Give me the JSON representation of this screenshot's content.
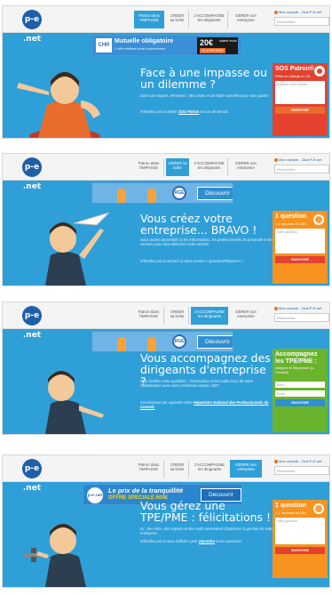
{
  "nav": {
    "items": [
      "Patron dans l'IMPASSE",
      "CRÉER sa boîte",
      "J'ACCOMPAGNE les dirigeants",
      "GÉRER son entreprise"
    ],
    "account": "Mon compte - Club P-E.net",
    "search_placeholder": "Rechercher",
    "logo": "p-e .net"
  },
  "panels": [
    {
      "banner": {
        "title": "Mutuelle obligatoire",
        "sub": "L'offre défiant toute concurrence",
        "price": "20€",
        "price_note": "salarié /mois",
        "cta": "JE M'INFORME",
        "logo": "CHR"
      },
      "heading": "Face à une impasse ou un dilemme ?",
      "para": "Dans cet espace, retrouvez : des pistes et de l'aide concrète pour vous guider",
      "para2_pre": "N'hésitez pas à utiliser ",
      "para2_link": "SOS Patron",
      "para2_post": " en cas de besoin",
      "side": {
        "title": "SOS Patron®",
        "sub": "Prise en charge en 1h",
        "input": "Indiquez votre besoin",
        "button": "ENVOYER"
      }
    },
    {
      "banner": {
        "cta": "Découvrir",
        "badge": "RGE"
      },
      "heading": "Vous créez votre entreprise... BRAVO !",
      "para": "Nous avons rassemblé ici les informations, les professionnels de proximité et les services pour bien démarrer votre activité.",
      "para2": "N'hésitez pas à recourir à notre service « Question/Réponse ».",
      "side": {
        "title": "1 question",
        "sub": "= 1 réponse en 24h",
        "input": "Votre question",
        "button": "ENVOYER"
      }
    },
    {
      "banner": {
        "cta": "Découvrir",
        "badge": "RGE"
      },
      "heading": "Vous accompagnez des dirigeants d'entreprise ?",
      "para": "Pour faciliter votre quotidien : l'information et les outils issus de notre collaboration avec votre profession depuis 2007.",
      "para2_pre": "Commencez par rejoindre notre ",
      "para2_link": "Répertoire National des Professionnels du Conseil.",
      "side": {
        "title": "Accompagnez les TPE/PME :",
        "sub": "Intégrez le Répertoire (s. Conseil)",
        "input1": "Nom",
        "input2": "Email",
        "button": "ENVOYER"
      }
    },
    {
      "banner": {
        "title": "Le prix de la tranquillité",
        "offer": "OFFRE SPECIALE 600€",
        "cta": "Découvrir",
        "logo": "p-e .net"
      },
      "heading": "Vous gérez une TPE/PME : félicitations !",
      "para": "Ici : des infos, des experts et des outils permettent d'optimiser la gestion de votre entreprise.",
      "para2_pre": "N'hésitez pas à nous solliciter pour ",
      "para2_link": "répondre",
      "para2_post": " à vos questions.",
      "side": {
        "title": "1 question",
        "sub": "= 1 réponse en 24h",
        "input": "Votre question",
        "button": "ENVOYER"
      }
    }
  ],
  "active_nav": [
    0,
    1,
    2,
    3
  ],
  "colors": {
    "blue": "#2f9fd8",
    "orange": "#e86c2b",
    "green": "#6ab42d",
    "red": "#e4412f"
  }
}
